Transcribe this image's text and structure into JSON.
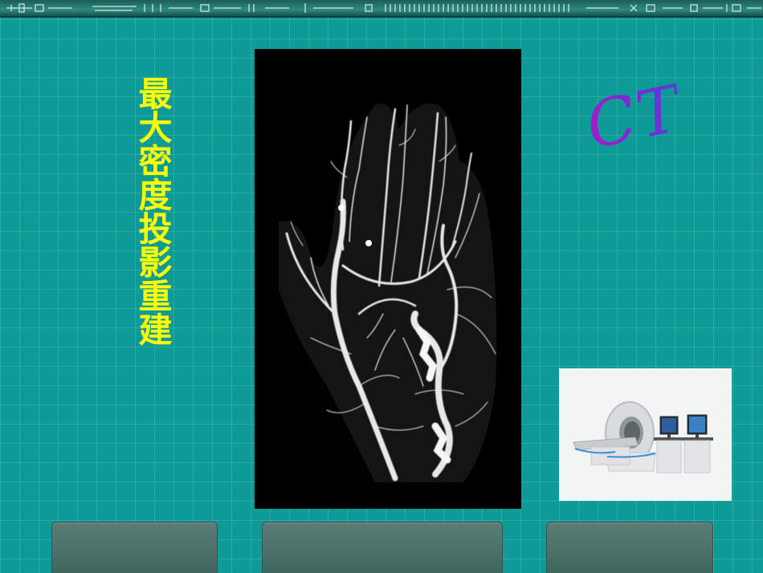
{
  "slide": {
    "title_vertical": "最大密度投影重建",
    "ct_label": "CT"
  },
  "images": {
    "angiogram": "hand-angiography-mip-icon",
    "scanner": "ct-scanner-icon"
  },
  "colors": {
    "background": "#0e9b98",
    "title": "#ffff00",
    "ct_label": "#8a25d0",
    "bottom_tab": "#4a6f68"
  }
}
